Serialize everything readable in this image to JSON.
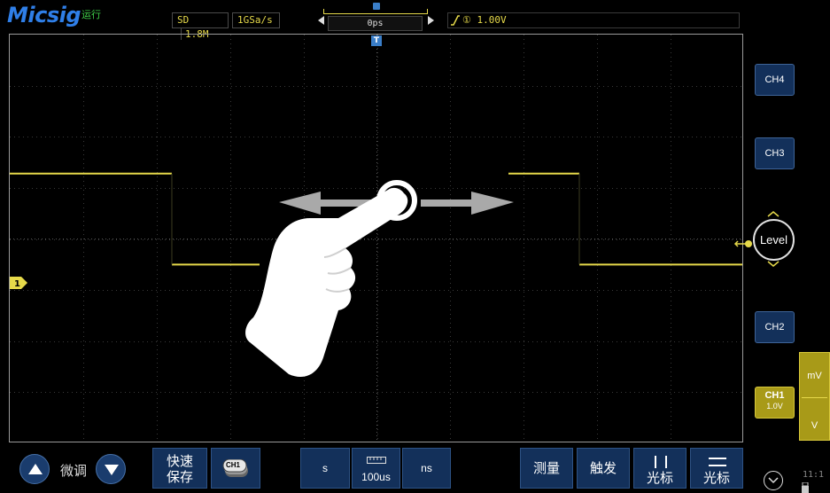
{
  "header": {
    "brand": "Micsig",
    "run_status": "运行",
    "memory_depth_label": "SD",
    "memory_depth": "1.8M",
    "sample_rate": "1GSa/s",
    "horizontal_position": "0ps",
    "trigger_info": "① 1.00V"
  },
  "right_panel": {
    "ch4_label": "CH4",
    "ch3_label": "CH3",
    "level_label": "Level",
    "ch2_label": "CH2",
    "ch1_label": "CH1",
    "ch1_scale": "1.0V",
    "vscale_up_label": "mV",
    "vscale_down_label": "V"
  },
  "toolbar": {
    "fine_tune_label": "微调",
    "quick_save_line1": "快速",
    "quick_save_line2": "保存",
    "ch1_chip": "CH1",
    "timebase_up_label": "s",
    "timebase_value": "100us",
    "timebase_down_label": "ns",
    "measure_label": "测量",
    "trigger_label": "触发",
    "cursor_v_label": "光标",
    "cursor_h_label": "光标"
  },
  "status": {
    "clock": "11:1"
  },
  "colors": {
    "trace_ch1": "#e6d94a",
    "button_bg": "#13305a",
    "accent_blue": "#3a7ec8",
    "run_green": "#3fd04a"
  },
  "waveform": {
    "channel": "CH1",
    "shape": "square",
    "high_level_div": 1,
    "low_level_div": -1,
    "time_div": [
      -5,
      5
    ]
  }
}
